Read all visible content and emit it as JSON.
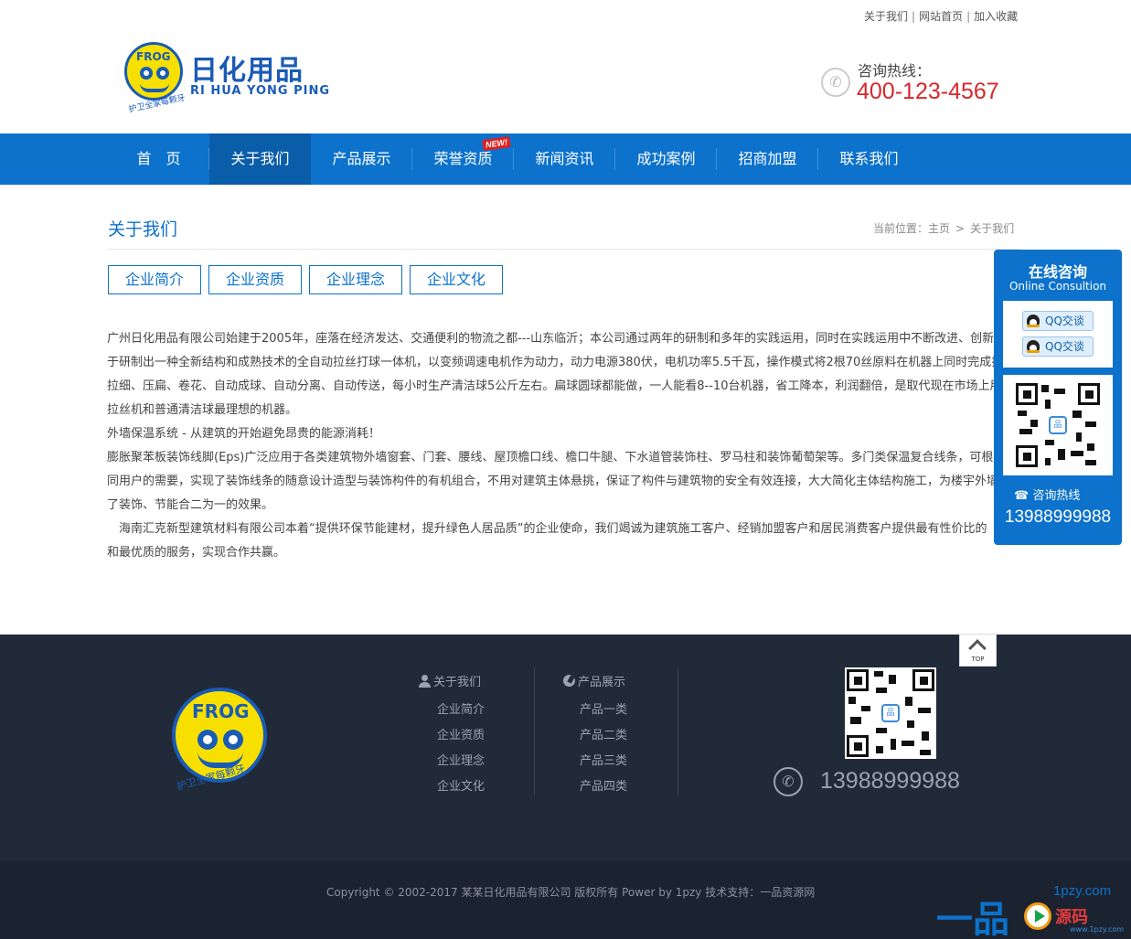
{
  "top_links": [
    "关于我们",
    "网站首页",
    "加入收藏"
  ],
  "logo": {
    "badge": "FROG",
    "name_cn": "日化用品",
    "name_en": "RI HUA YONG PING",
    "slogan": "护卫全家每颗牙"
  },
  "hotline": {
    "label": "咨询热线：",
    "number": "400-123-4567"
  },
  "nav": {
    "items": [
      "首　页",
      "关于我们",
      "产品展示",
      "荣誉资质",
      "新闻资讯",
      "成功案例",
      "招商加盟",
      "联系我们"
    ],
    "active_index": 1,
    "badge": "NEW!"
  },
  "page": {
    "title": "关于我们",
    "breadcrumb": {
      "prefix": "当前位置：",
      "home": "主页",
      "separator": ">",
      "current": "关于我们"
    },
    "subtabs": [
      "企业简介",
      "企业资质",
      "企业理念",
      "企业文化"
    ]
  },
  "content": {
    "lines": [
      "广州日化用品有限公司始建于2005年，座落在经济发达、交通便利的物流之都---山东临沂；本公司通过两年的研制和多年的实践运用，同时在实践运用中不断改进、创新",
      "于研制出一种全新结构和成熟技术的全自动拉丝打球一体机，以变频调速电机作为动力，动力电源380伏，电机功率5.5千瓦，操作模式将2根70丝原料在机器上同时完成拉",
      "拉细、压扁、卷花、自动成球、自动分离、自动传送，每小时生产清洁球5公斤左右。扁球圆球都能做，一人能看8--10台机器，省工降本，利润翻倍，是取代现在市场上用",
      "拉丝机和普通清洁球最理想的机器。",
      "外墙保温系统 - 从建筑的开始避免昂贵的能源消耗！",
      "膨胀聚苯板装饰线脚(Eps)广泛应用于各类建筑物外墙窗套、门套、腰线、屋顶檐口线、檐口牛腿、下水道管装饰柱、罗马柱和装饰葡萄架等。多门类保温复合线条，可根",
      "同用户的需要，实现了装饰线条的随意设计造型与装饰构件的有机组合，不用对建筑主体悬挑，保证了构件与建筑物的安全有效连接，大大简化主体结构施工，为楼宇外墙",
      "了装饰、节能合二为一的效果。",
      "　海南汇克新型建筑材料有限公司本着“提供环保节能建材，提升绿色人居品质”的企业使命，我们竭诚为建筑施工客户、经销加盟客户和居民消费客户提供最有性价比的",
      "和最优质的服务，实现合作共赢。"
    ]
  },
  "float_panel": {
    "title": "在线咨询",
    "subtitle": "Online Consultion",
    "qq_buttons": [
      "QQ交谈",
      "QQ交谈"
    ],
    "hotline_label": "咨询热线",
    "hotline_number": "13988999988"
  },
  "back_to_top": "TOP",
  "footer": {
    "col1": {
      "heading": "关于我们",
      "links": [
        "企业简介",
        "企业资质",
        "企业理念",
        "企业文化"
      ]
    },
    "col2": {
      "heading": "产品展示",
      "links": [
        "产品一类",
        "产品二类",
        "产品三类",
        "产品四类"
      ]
    },
    "phone": "13988999988",
    "copyright": "Copyright © 2002-2017 某某日化用品有限公司 版权所有 Power by 1pzy 技术支持：一品资源网"
  },
  "watermark": {
    "big": "一品",
    "domain": "1pzy.com",
    "source": "源码",
    "small": "www.1pzy.com"
  },
  "colors": {
    "brand_blue": "#0c72cc",
    "nav_active": "#0a5da8",
    "hotline_red": "#d9262c",
    "footer_bg": "#212a38",
    "logo_yellow": "#f7e000"
  }
}
